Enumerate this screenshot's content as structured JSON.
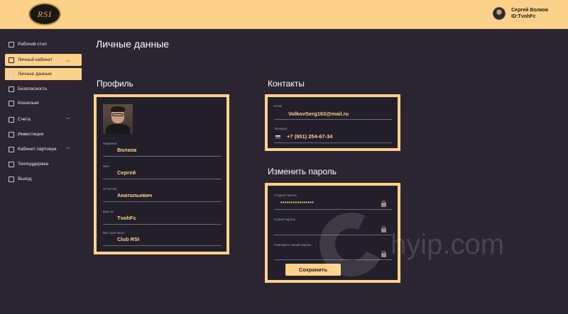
{
  "header": {
    "logo_text": "RSI",
    "user_name": "Сергей Волков",
    "user_id": "ID:TvohFc"
  },
  "sidebar": {
    "items": [
      {
        "label": "Рабочий стол",
        "icon": "dashboard-icon"
      },
      {
        "label": "Личный кабинет",
        "icon": "person-icon"
      },
      {
        "label": "Личные данные",
        "icon": "id-card-icon"
      },
      {
        "label": "Безопасность",
        "icon": "lock-icon"
      },
      {
        "label": "Кошельки",
        "icon": "wallet-icon"
      },
      {
        "label": "Счета",
        "icon": "bank-icon"
      },
      {
        "label": "Инвестиции",
        "icon": "monitor-icon"
      },
      {
        "label": "Кабинет партнера",
        "icon": "network-icon"
      },
      {
        "label": "Техподдержка",
        "icon": "support-icon"
      },
      {
        "label": "Выход",
        "icon": "exit-icon"
      }
    ]
  },
  "page": {
    "title": "Личные данные"
  },
  "profile": {
    "title": "Профиль",
    "fields": [
      {
        "label": "Фамилия",
        "value": "Волков"
      },
      {
        "label": "Имя",
        "value": "Сергей"
      },
      {
        "label": "Отчество",
        "value": "Анатольевич"
      },
      {
        "label": "Ваш ID",
        "value": "TvohFc"
      },
      {
        "label": "Вас пригласил",
        "value": "Club RSI"
      }
    ]
  },
  "contacts": {
    "title": "Контакты",
    "email_label": "Email",
    "email_value": "VolkovSerg163@mail.ru",
    "phone_label": "Телефон",
    "phone_value": "+7 (951) 254-67-34"
  },
  "password": {
    "title": "Изменить пароль",
    "old_label": "Старый пароль",
    "old_value": "••••••••••••••••",
    "new_label": "Новый пароль",
    "repeat_label": "Повторите новый пароль",
    "save_label": "Сохранить"
  },
  "watermark": {
    "text": "hyip.com"
  },
  "colors": {
    "accent": "#fcd28a",
    "background": "#2a2531"
  }
}
